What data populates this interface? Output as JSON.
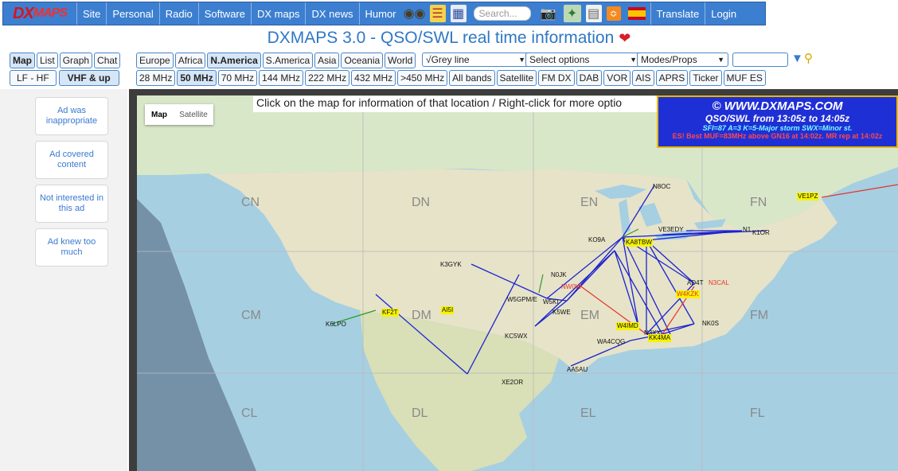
{
  "nav": {
    "logo_a": "DX",
    "logo_b": "MAPS",
    "items": [
      "Site",
      "Personal",
      "Radio",
      "Software",
      "DX maps",
      "DX news",
      "Humor"
    ],
    "search_placeholder": "Search...",
    "translate": "Translate",
    "login": "Login"
  },
  "title": "DXMAPS 3.0 - QSO/SWL real time information",
  "view_tabs": [
    "Map",
    "List",
    "Graph",
    "Chat"
  ],
  "active_view": "Map",
  "band_groups": [
    "LF - HF",
    "VHF & up"
  ],
  "active_band_group": "VHF & up",
  "regions": [
    "Europe",
    "Africa",
    "N.America",
    "S.America",
    "Asia",
    "Oceania",
    "World"
  ],
  "active_region": "N.America",
  "bands": [
    "28 MHz",
    "50 MHz",
    "70 MHz",
    "144 MHz",
    "222 MHz",
    "432 MHz",
    ">450 MHz",
    "All bands",
    "Satellite",
    "FM DX",
    "DAB",
    "VOR",
    "AIS",
    "APRS",
    "Ticker",
    "MUF ES"
  ],
  "active_band": "50 MHz",
  "selects": {
    "greyline": "√Grey line",
    "options": "Select options",
    "modes": "Modes/Props"
  },
  "ads": [
    "Ad was inappropriate",
    "Ad covered content",
    "Not interested in this ad",
    "Ad knew too much"
  ],
  "map": {
    "toggle": [
      "Map",
      "Satellite"
    ],
    "info": "Click on the map for information of that location / Right-click for more optio",
    "copyright": "© WWW.DXMAPS.COM",
    "qso_range": "QSO/SWL from 13:05z to 14:05z",
    "solar": "SFI=87 A=3 K=5-Major storm SWX=Minor st.",
    "es_line": "ES! Best MUF=83MHz above GN16 at 14:02z. MR rep at 14:02z",
    "grids": [
      "CN",
      "DN",
      "EN",
      "FN",
      "CM",
      "DM",
      "EM",
      "FM",
      "CL",
      "DL",
      "EL",
      "FL"
    ],
    "stations": [
      "N8OC",
      "VE1PZ",
      "VE3EDY",
      "N1",
      "K1OR",
      "KO9A",
      "KA8TBW",
      "K3GYK",
      "N0JK",
      "NW0W",
      "AD4T",
      "N3CAL",
      "W4KZK",
      "W5GPM/E",
      "W5KI",
      "K5WE",
      "KF2T",
      "AI5I",
      "K6LPO",
      "W4IMD",
      "N3XX",
      "NK0S",
      "WA4CQG",
      "KK4MA",
      "KC5WX",
      "AA5AU",
      "XE2OR"
    ]
  }
}
